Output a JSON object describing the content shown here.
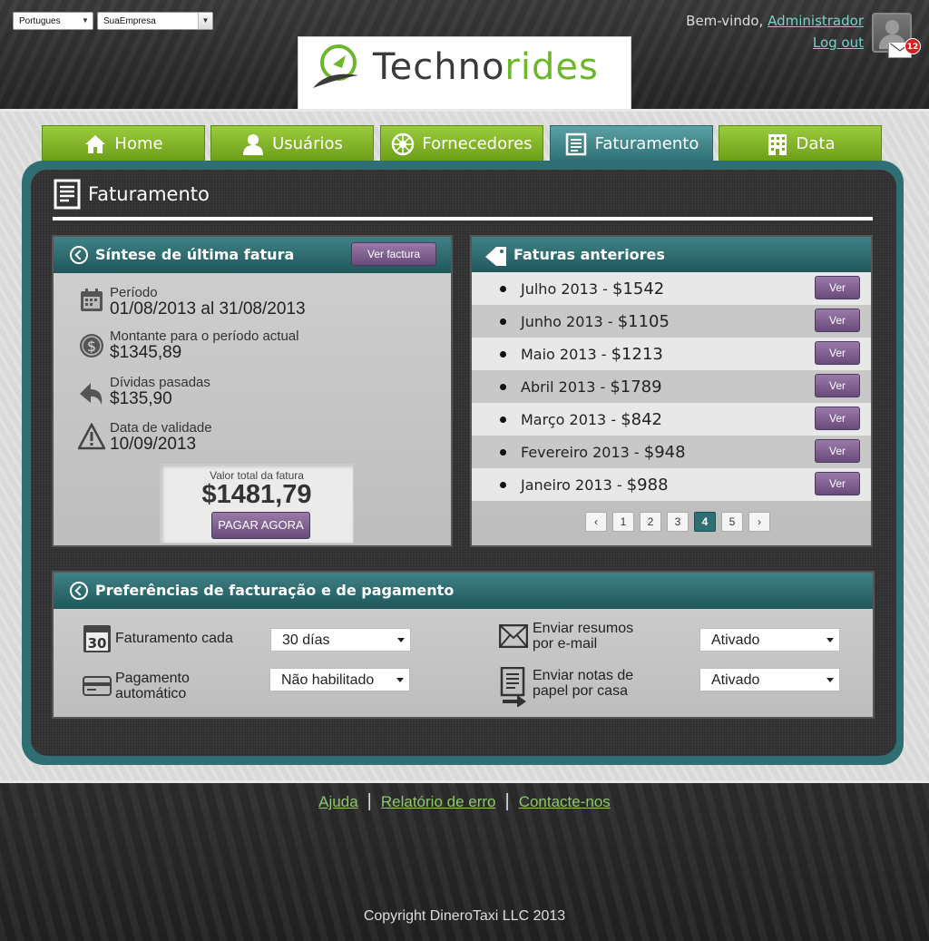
{
  "header": {
    "language": "Portugues",
    "company": "SuaEmpresa",
    "welcome_text": "Bem-vindo, ",
    "user_name": "Administrador",
    "logout": "Log out",
    "notifications": "12",
    "logo_text_dark": "Techno",
    "logo_text_green": "rides"
  },
  "tabs": [
    {
      "label": "Home",
      "icon": "home-icon"
    },
    {
      "label": "Usuários",
      "icon": "user-icon"
    },
    {
      "label": "Fornecedores",
      "icon": "wheel-icon"
    },
    {
      "label": "Faturamento",
      "icon": "invoice-icon"
    },
    {
      "label": "Data",
      "icon": "building-icon"
    }
  ],
  "active_tab": "Faturamento",
  "page": {
    "title": "Faturamento"
  },
  "summary": {
    "title": "Síntese de última fatura",
    "view_button": "Ver factura",
    "period_label": "Período",
    "period_value": "01/08/2013 al 31/08/2013",
    "amount_label": "Montante para o período actual",
    "amount_value": "$1345,89",
    "debt_label": "Dívidas pasadas",
    "debt_value": "$135,90",
    "due_label": "Data de validade",
    "due_value": "10/09/2013",
    "total_label": "Valor total da fatura",
    "total_value": "$1481,79",
    "pay_button": "PAGAR AGORA"
  },
  "previous": {
    "title": "Faturas anteriores",
    "view_label": "Ver",
    "items": [
      {
        "month": "Julho 2013",
        "sep": " - ",
        "amount": "$1542"
      },
      {
        "month": "Junho 2013",
        "sep": " - ",
        "amount": "$1105"
      },
      {
        "month": "Maio 2013",
        "sep": " - ",
        "amount": "$1213"
      },
      {
        "month": "Abril 2013",
        "sep": " - ",
        "amount": "$1789"
      },
      {
        "month": "Março 2013",
        "sep": " - ",
        "amount": "$842"
      },
      {
        "month": "Fevereiro 2013",
        "sep": " - ",
        "amount": "$948"
      },
      {
        "month": "Janeiro 2013",
        "sep": " - ",
        "amount": "$988"
      }
    ],
    "pagination": {
      "prev": "‹",
      "next": "›",
      "pages": [
        "1",
        "2",
        "3",
        "4",
        "5"
      ],
      "current": "4"
    }
  },
  "preferences": {
    "title": "Preferências de facturação e de pagamento",
    "calendar_badge": "30",
    "billing_label": "Faturamento cada",
    "billing_value": "30 días",
    "autopay_label_1": "Pagamento",
    "autopay_label_2": "automático",
    "autopay_value": "Não habilitado",
    "email_label_1": "Enviar resumos",
    "email_label_2": "por e-mail",
    "email_value": "Ativado",
    "paper_label_1": "Enviar notas de",
    "paper_label_2": "papel por casa",
    "paper_value": "Ativado"
  },
  "footer": {
    "links": [
      "Ajuda",
      "Relatório de erro",
      "Contacte-nos"
    ],
    "separator": "|",
    "copyright": "Copyright DineroTaxi LLC 2013"
  },
  "colors": {
    "accent_teal": "#2e6f74",
    "tab_green": "#7fb32a",
    "button_purple": "#7a5a8a",
    "link_teal": "#7ed1c8",
    "footer_link_green": "#8ec86a"
  }
}
